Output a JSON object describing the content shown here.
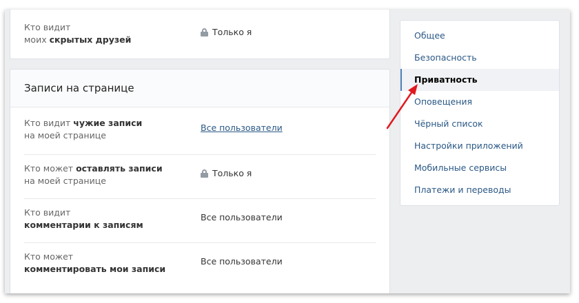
{
  "top_row": {
    "label_plain": "Кто видит",
    "label_line2_plain": "моих ",
    "label_line2_bold": "скрытых друзей",
    "value": "Только я"
  },
  "section": {
    "title": "Записи на странице",
    "rows": [
      {
        "plain1": "Кто видит ",
        "bold1": "чужие записи",
        "line2": "на моей странице",
        "value": "Все пользователи",
        "value_is_link": true
      },
      {
        "plain1": "Кто может ",
        "bold1": "оставлять записи",
        "line2": "на моей странице",
        "value": "Только я",
        "locked": true
      },
      {
        "plain1": "Кто видит",
        "bold2": "комментарии к записям",
        "value": "Все пользователи"
      },
      {
        "plain1": "Кто может",
        "bold2": "комментировать мои записи",
        "value": "Все пользователи"
      }
    ]
  },
  "menu": {
    "items": [
      {
        "label": "Общее"
      },
      {
        "label": "Безопасность"
      },
      {
        "label": "Приватность",
        "active": true
      },
      {
        "label": "Оповещения"
      },
      {
        "label": "Чёрный список"
      },
      {
        "label": "Настройки приложений"
      },
      {
        "label": "Мобильные сервисы"
      },
      {
        "label": "Платежи и переводы"
      }
    ]
  },
  "colors": {
    "link": "#2a5885",
    "accent": "#5181b8",
    "arrow": "#e0191f",
    "page_bg": "#edeef0"
  },
  "icons": {
    "lock": "lock-icon",
    "arrow": "red-arrow-annotation"
  }
}
